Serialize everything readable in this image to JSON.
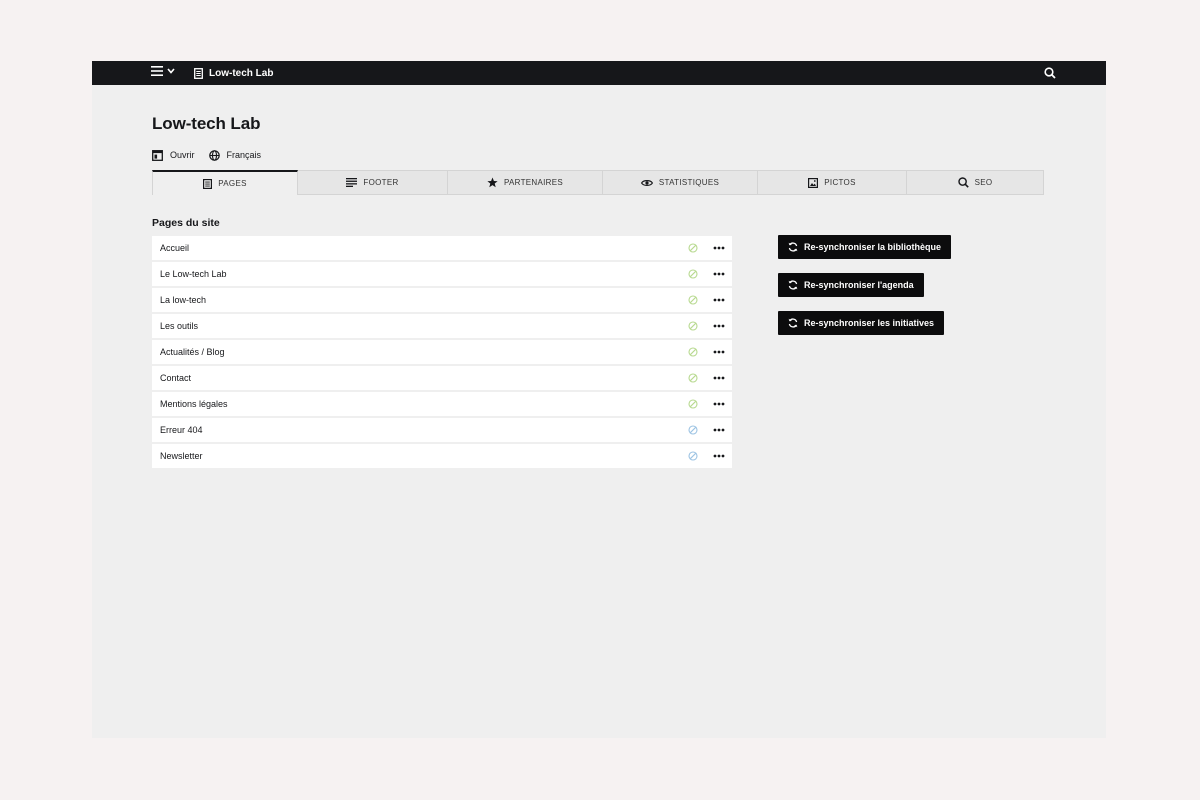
{
  "topbar": {
    "site_name": "Low-tech Lab"
  },
  "header": {
    "title": "Low-tech Lab",
    "open_label": "Ouvrir",
    "language_label": "Français"
  },
  "tabs": [
    {
      "label": "PAGES",
      "icon": "page-icon",
      "active": true
    },
    {
      "label": "FOOTER",
      "icon": "lines-icon",
      "active": false
    },
    {
      "label": "PARTENAIRES",
      "icon": "star-icon",
      "active": false
    },
    {
      "label": "STATISTIQUES",
      "icon": "eye-icon",
      "active": false
    },
    {
      "label": "PICTOS",
      "icon": "image-icon",
      "active": false
    },
    {
      "label": "SEO",
      "icon": "search-icon",
      "active": false
    }
  ],
  "pages_section": {
    "title": "Pages du site",
    "items": [
      {
        "label": "Accueil",
        "status": "public",
        "status_color": "#b7d98f"
      },
      {
        "label": "Le Low-tech Lab",
        "status": "public",
        "status_color": "#b7d98f"
      },
      {
        "label": "La low-tech",
        "status": "public",
        "status_color": "#b7d98f"
      },
      {
        "label": "Les outils",
        "status": "public",
        "status_color": "#b7d98f"
      },
      {
        "label": "Actualités / Blog",
        "status": "public",
        "status_color": "#b7d98f"
      },
      {
        "label": "Contact",
        "status": "public",
        "status_color": "#b7d98f"
      },
      {
        "label": "Mentions légales",
        "status": "public",
        "status_color": "#b7d98f"
      },
      {
        "label": "Erreur 404",
        "status": "unlisted",
        "status_color": "#9cc3e3"
      },
      {
        "label": "Newsletter",
        "status": "unlisted",
        "status_color": "#9cc3e3"
      }
    ]
  },
  "actions": {
    "sync_library": "Re-synchroniser la bibliothèque",
    "sync_agenda": "Re-synchroniser l'agenda",
    "sync_initiatives": "Re-synchroniser les initiatives"
  }
}
